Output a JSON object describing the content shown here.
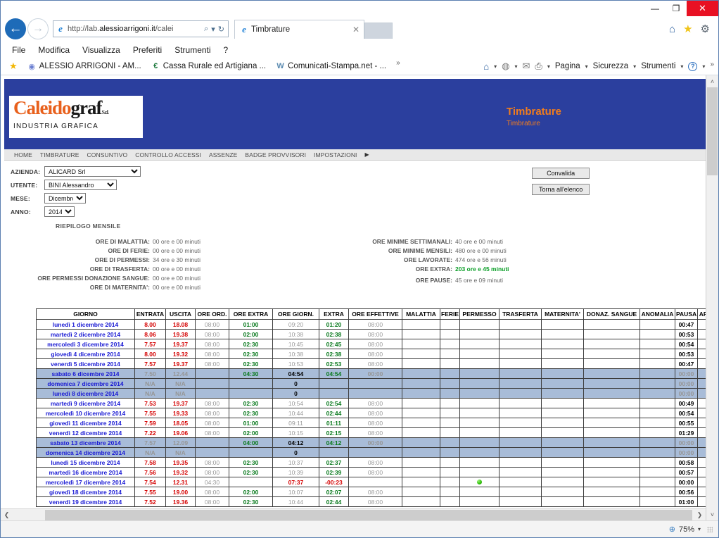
{
  "window": {
    "minimize": "—",
    "maximize": "❐",
    "close": "✕"
  },
  "browser": {
    "back_icon": "←",
    "forward_icon": "→",
    "address": {
      "prefix": "http://lab.",
      "bold": "alessioarrigoni.it",
      "suffix": "/calei",
      "search_icon": "⌕",
      "dropdown_icon": "▾",
      "refresh_icon": "↻"
    },
    "tab": {
      "title": "Timbrature",
      "close": "✕"
    },
    "toolbar_icons": {
      "home": "⌂",
      "favorites": "★",
      "settings": "⚙"
    },
    "menu": [
      "File",
      "Modifica",
      "Visualizza",
      "Preferiti",
      "Strumenti",
      "?"
    ],
    "favorites": [
      {
        "label": "ALESSIO ARRIGONI - AM...",
        "icon": "◉"
      },
      {
        "label": "Cassa Rurale ed Artigiana ...",
        "icon": "€"
      },
      {
        "label": "Comunicati-Stampa.net - ...",
        "icon": "W"
      }
    ],
    "favorites_overflow": "»",
    "command_bar": {
      "home_icon": "⌂",
      "feeds_icon": "◍",
      "mail_icon": "✉",
      "print_icon": "⎙",
      "page": "Pagina",
      "safety": "Sicurezza",
      "tools": "Strumenti",
      "help_icon": "?",
      "overflow": "»",
      "dropdown": "▾"
    }
  },
  "site": {
    "logo": {
      "part1": "Caleido",
      "part2": "graf",
      "sub": "S.r.l.",
      "tagline": "INDUSTRIA GRAFICA"
    },
    "banner_title": "Timbrature",
    "banner_subtitle": "Timbrature",
    "nav": [
      "HOME",
      "TIMBRATURE",
      "CONSUNTIVO",
      "CONTROLLO ACCESSI",
      "ASSENZE",
      "BADGE PROVVISORI",
      "IMPOSTAZIONI"
    ],
    "nav_arrow": "▶"
  },
  "form": {
    "fields": [
      {
        "label": "AZIENDA:",
        "value": "ALICARD Srl"
      },
      {
        "label": "UTENTE:",
        "value": "BINI Alessandro"
      },
      {
        "label": "MESE:",
        "value": "Dicembre"
      },
      {
        "label": "ANNO:",
        "value": "2014"
      }
    ],
    "riepilogo_title": "RIEPILOGO MENSILE",
    "buttons": [
      {
        "label": "Convalida"
      },
      {
        "label": "Torna all'elenco"
      }
    ]
  },
  "summary": {
    "left": [
      {
        "key": "ORE DI MALATTIA:",
        "value": "00 ore e 00 minuti"
      },
      {
        "key": "ORE DI FERIE:",
        "value": "00 ore e 00 minuti"
      },
      {
        "key": "ORE DI PERMESSI:",
        "value": "34 ore e 30 minuti"
      },
      {
        "key": "ORE DI TRASFERTA:",
        "value": "00 ore e 00 minuti"
      },
      {
        "key": "ORE PERMESSI DONAZIONE SANGUE:",
        "value": "00 ore e 00 minuti"
      },
      {
        "key": "ORE DI MATERNITA':",
        "value": "00 ore e 00 minuti"
      }
    ],
    "right": [
      {
        "key": "ORE MINIME SETTIMANALI:",
        "value": "40 ore e 00 minuti"
      },
      {
        "key": "ORE MINIME MENSILI:",
        "value": "480 ore e 00 minuti"
      },
      {
        "key": "ORE LAVORATE:",
        "value": "474 ore e 56 minuti"
      },
      {
        "key": "ORE EXTRA:",
        "value": "203 ore e 45 minuti",
        "highlight": "green"
      },
      {
        "key": "ORE PAUSE:",
        "value": "45 ore e 09 minuti"
      }
    ]
  },
  "table": {
    "columns": [
      "GIORNO",
      "ENTRATA",
      "USCITA",
      "ORE ORD.",
      "ORE EXTRA",
      "ORE GIORN.",
      "EXTRA",
      "ORE EFFETTIVE",
      "MALATTIA",
      "FERIE",
      "PERMESSO",
      "TRASFERTA",
      "MATERNITA'",
      "DONAZ. SANGUE",
      "ANOMALIA",
      "PAUSA",
      "APPROVATA"
    ],
    "rows": [
      {
        "weekend": false,
        "giorno": "lunedì 1 dicembre 2014",
        "entrata": "8.00",
        "uscita": "18.08",
        "ore_ord": "08:00",
        "ore_extra": "01:00",
        "ore_giorn": "09:20",
        "extra": "01:20",
        "ore_eff": "08:00",
        "malattia": "",
        "ferie": "",
        "permesso": "",
        "trasferta": "",
        "maternita": "",
        "donaz": "",
        "anomalia": "",
        "pausa": "00:47",
        "approvata": "red"
      },
      {
        "weekend": false,
        "giorno": "martedì 2 dicembre 2014",
        "entrata": "8.06",
        "uscita": "19.38",
        "ore_ord": "08:00",
        "ore_extra": "02:00",
        "ore_giorn": "10:38",
        "extra": "02:38",
        "ore_eff": "08:00",
        "malattia": "",
        "ferie": "",
        "permesso": "",
        "trasferta": "",
        "maternita": "",
        "donaz": "",
        "anomalia": "",
        "pausa": "00:53",
        "approvata": "red"
      },
      {
        "weekend": false,
        "giorno": "mercoledì 3 dicembre 2014",
        "entrata": "7.57",
        "uscita": "19.37",
        "ore_ord": "08:00",
        "ore_extra": "02:30",
        "ore_giorn": "10:45",
        "extra": "02:45",
        "ore_eff": "08:00",
        "malattia": "",
        "ferie": "",
        "permesso": "",
        "trasferta": "",
        "maternita": "",
        "donaz": "",
        "anomalia": "",
        "pausa": "00:54",
        "approvata": "red"
      },
      {
        "weekend": false,
        "giorno": "giovedì 4 dicembre 2014",
        "entrata": "8.00",
        "uscita": "19.32",
        "ore_ord": "08:00",
        "ore_extra": "02:30",
        "ore_giorn": "10:38",
        "extra": "02:38",
        "ore_eff": "08:00",
        "malattia": "",
        "ferie": "",
        "permesso": "",
        "trasferta": "",
        "maternita": "",
        "donaz": "",
        "anomalia": "",
        "pausa": "00:53",
        "approvata": "red"
      },
      {
        "weekend": false,
        "giorno": "venerdì 5 dicembre 2014",
        "entrata": "7.57",
        "uscita": "19.37",
        "ore_ord": "08:00",
        "ore_extra": "02:30",
        "ore_giorn": "10:53",
        "extra": "02:53",
        "ore_eff": "08:00",
        "malattia": "",
        "ferie": "",
        "permesso": "",
        "trasferta": "",
        "maternita": "",
        "donaz": "",
        "anomalia": "",
        "pausa": "00:47",
        "approvata": "red"
      },
      {
        "weekend": true,
        "giorno": "sabato 6 dicembre 2014",
        "entrata": "7.50",
        "uscita": "12.44",
        "ore_ord": "",
        "ore_extra": "04:30",
        "ore_giorn": "04:54",
        "extra": "04:54",
        "ore_eff": "00:00",
        "malattia": "",
        "ferie": "",
        "permesso": "",
        "trasferta": "",
        "maternita": "",
        "donaz": "",
        "anomalia": "",
        "pausa": "00:00",
        "approvata": "red"
      },
      {
        "weekend": true,
        "giorno": "domenica 7 dicembre 2014",
        "entrata": "N/A",
        "uscita": "N/A",
        "ore_ord": "",
        "ore_extra": "",
        "ore_giorn": "0",
        "extra": "",
        "ore_eff": "",
        "malattia": "",
        "ferie": "",
        "permesso": "",
        "trasferta": "",
        "maternita": "",
        "donaz": "",
        "anomalia": "",
        "pausa": "00:00",
        "approvata": ""
      },
      {
        "weekend": true,
        "giorno": "lunedì 8 dicembre 2014",
        "entrata": "N/A",
        "uscita": "N/A",
        "ore_ord": "",
        "ore_extra": "",
        "ore_giorn": "0",
        "extra": "",
        "ore_eff": "",
        "malattia": "",
        "ferie": "",
        "permesso": "",
        "trasferta": "",
        "maternita": "",
        "donaz": "",
        "anomalia": "",
        "pausa": "00:00",
        "approvata": ""
      },
      {
        "weekend": false,
        "giorno": "martedì 9 dicembre 2014",
        "entrata": "7.53",
        "uscita": "19.37",
        "ore_ord": "08:00",
        "ore_extra": "02:30",
        "ore_giorn": "10:54",
        "extra": "02:54",
        "ore_eff": "08:00",
        "malattia": "",
        "ferie": "",
        "permesso": "",
        "trasferta": "",
        "maternita": "",
        "donaz": "",
        "anomalia": "",
        "pausa": "00:49",
        "approvata": "red"
      },
      {
        "weekend": false,
        "giorno": "mercoledì 10 dicembre 2014",
        "entrata": "7.55",
        "uscita": "19.33",
        "ore_ord": "08:00",
        "ore_extra": "02:30",
        "ore_giorn": "10:44",
        "extra": "02:44",
        "ore_eff": "08:00",
        "malattia": "",
        "ferie": "",
        "permesso": "",
        "trasferta": "",
        "maternita": "",
        "donaz": "",
        "anomalia": "",
        "pausa": "00:54",
        "approvata": "red"
      },
      {
        "weekend": false,
        "giorno": "giovedì 11 dicembre 2014",
        "entrata": "7.59",
        "uscita": "18.05",
        "ore_ord": "08:00",
        "ore_extra": "01:00",
        "ore_giorn": "09:11",
        "extra": "01:11",
        "ore_eff": "08:00",
        "malattia": "",
        "ferie": "",
        "permesso": "",
        "trasferta": "",
        "maternita": "",
        "donaz": "",
        "anomalia": "",
        "pausa": "00:55",
        "approvata": "red"
      },
      {
        "weekend": false,
        "giorno": "venerdì 12 dicembre 2014",
        "entrata": "7.22",
        "uscita": "19.06",
        "ore_ord": "08:00",
        "ore_extra": "02:00",
        "ore_giorn": "10:15",
        "extra": "02:15",
        "ore_eff": "08:00",
        "malattia": "",
        "ferie": "",
        "permesso": "",
        "trasferta": "",
        "maternita": "",
        "donaz": "",
        "anomalia": "",
        "pausa": "01:29",
        "approvata": "red"
      },
      {
        "weekend": true,
        "giorno": "sabato 13 dicembre 2014",
        "entrata": "7.57",
        "uscita": "12.09",
        "ore_ord": "",
        "ore_extra": "04:00",
        "ore_giorn": "04:12",
        "extra": "04:12",
        "ore_eff": "00:00",
        "malattia": "",
        "ferie": "",
        "permesso": "",
        "trasferta": "",
        "maternita": "",
        "donaz": "",
        "anomalia": "",
        "pausa": "00:00",
        "approvata": "red"
      },
      {
        "weekend": true,
        "giorno": "domenica 14 dicembre 2014",
        "entrata": "N/A",
        "uscita": "N/A",
        "ore_ord": "",
        "ore_extra": "",
        "ore_giorn": "0",
        "extra": "",
        "ore_eff": "",
        "malattia": "",
        "ferie": "",
        "permesso": "",
        "trasferta": "",
        "maternita": "",
        "donaz": "",
        "anomalia": "",
        "pausa": "00:00",
        "approvata": ""
      },
      {
        "weekend": false,
        "giorno": "lunedì 15 dicembre 2014",
        "entrata": "7.58",
        "uscita": "19.35",
        "ore_ord": "08:00",
        "ore_extra": "02:30",
        "ore_giorn": "10:37",
        "extra": "02:37",
        "ore_eff": "08:00",
        "malattia": "",
        "ferie": "",
        "permesso": "",
        "trasferta": "",
        "maternita": "",
        "donaz": "",
        "anomalia": "",
        "pausa": "00:58",
        "approvata": "red"
      },
      {
        "weekend": false,
        "giorno": "martedì 16 dicembre 2014",
        "entrata": "7.56",
        "uscita": "19.32",
        "ore_ord": "08:00",
        "ore_extra": "02:30",
        "ore_giorn": "10:39",
        "extra": "02:39",
        "ore_eff": "08:00",
        "malattia": "",
        "ferie": "",
        "permesso": "",
        "trasferta": "",
        "maternita": "",
        "donaz": "",
        "anomalia": "",
        "pausa": "00:57",
        "approvata": "red"
      },
      {
        "weekend": false,
        "giorno": "mercoledì 17 dicembre 2014",
        "entrata": "7.54",
        "uscita": "12.31",
        "ore_ord": "04:30",
        "ore_extra": "",
        "ore_giorn": "07:37",
        "extra": "-00:23",
        "ore_eff": "",
        "malattia": "",
        "ferie": "",
        "permesso": "green",
        "trasferta": "",
        "maternita": "",
        "donaz": "",
        "anomalia": "",
        "pausa": "00:00",
        "approvata": "red"
      },
      {
        "weekend": false,
        "giorno": "giovedì 18 dicembre 2014",
        "entrata": "7.55",
        "uscita": "19.00",
        "ore_ord": "08:00",
        "ore_extra": "02:00",
        "ore_giorn": "10:07",
        "extra": "02:07",
        "ore_eff": "08:00",
        "malattia": "",
        "ferie": "",
        "permesso": "",
        "trasferta": "",
        "maternita": "",
        "donaz": "",
        "anomalia": "",
        "pausa": "00:56",
        "approvata": "red"
      },
      {
        "weekend": false,
        "giorno": "venerdì 19 dicembre 2014",
        "entrata": "7.52",
        "uscita": "19.36",
        "ore_ord": "08:00",
        "ore_extra": "02:30",
        "ore_giorn": "10:44",
        "extra": "02:44",
        "ore_eff": "08:00",
        "malattia": "",
        "ferie": "",
        "permesso": "",
        "trasferta": "",
        "maternita": "",
        "donaz": "",
        "anomalia": "",
        "pausa": "01:00",
        "approvata": "red"
      }
    ]
  },
  "status": {
    "zoom": "75%",
    "zoom_icon": "⊕",
    "dropdown": "▾"
  },
  "scroll": {
    "up_arrow": "˄",
    "down_arrow": "˅",
    "left_arrow": "❮",
    "right_arrow": "❯"
  },
  "colors": {
    "banner": "#2b3f9e",
    "accent_orange": "#f07c1e",
    "weekend_row": "#a8bcd8",
    "extra_green": "#0a7a1e",
    "time_red": "#d40000"
  }
}
